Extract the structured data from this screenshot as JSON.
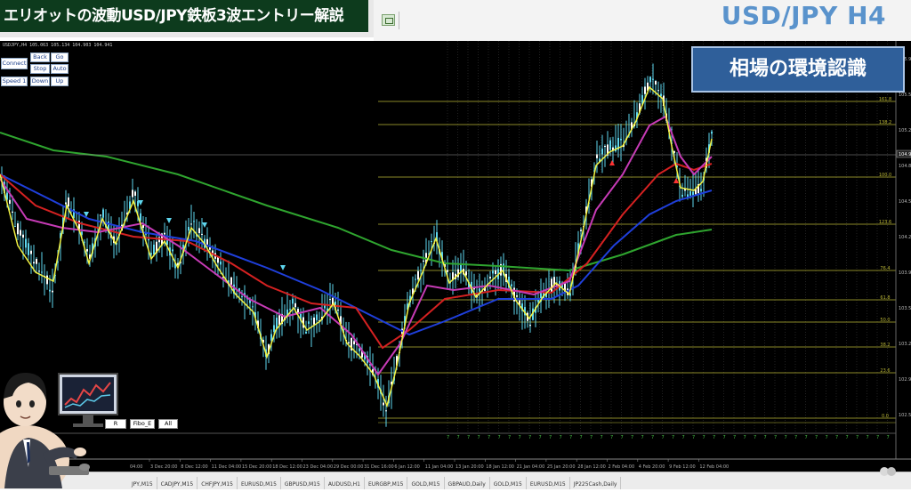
{
  "banner": {
    "title": "エリオットの波動USD/JPY鉄板3波エントリー解説"
  },
  "header": {
    "symbol_title": "USD/JPY H4"
  },
  "chart_header": {
    "info": "USDJPY,H4  105.063 105.134 104.903 104.941"
  },
  "controls": {
    "connect": "Connect",
    "back": "Back",
    "go": "Go",
    "stop": "Stop",
    "auto": "Auto",
    "speed": "Speed 1",
    "down": "Down",
    "up": "Up"
  },
  "fibo_buttons": {
    "fibo_r": "R",
    "fibo_e": "Fibo_E",
    "all": "All"
  },
  "overlay_label": "相場の環境認識",
  "price_labels": [
    "161.8",
    "138.2",
    "100.0",
    "123.6",
    "76.4",
    "61.8",
    "50.0",
    "38.2",
    "23.6",
    "0.0"
  ],
  "price_axis": [
    "105.9",
    "105.5",
    "105.2",
    "104.8",
    "104.5",
    "104.2",
    "103.9",
    "103.5",
    "103.2",
    "102.9",
    "102.5"
  ],
  "current_price": "104.94",
  "time_labels": [
    "3 Dec 20:00",
    "8 Dec 12:00",
    "11 Dec 04:00",
    "15 Dec 20:00",
    "18 Dec 12:00",
    "23 Dec 04:00",
    "29 Dec 00:00",
    "31 Dec 16:00",
    "6 Jan 12:00",
    "11 Jan 04:00",
    "13 Jan 20:00",
    "18 Jan 12:00",
    "21 Jan 04:00",
    "25 Jan 20:00",
    "28 Jan 12:00",
    "2 Feb 04:00",
    "4 Feb 20:00",
    "9 Feb 12:00",
    "12 Feb 04:00"
  ],
  "time_label_first": "04:00",
  "tabs": [
    "JPY,M15",
    "CADJPY,M15",
    "CHFJPY,M15",
    "EURUSD,M15",
    "GBPUSD,M15",
    "AUDUSD,H1",
    "EURGBP,M15",
    "GOLD,M15",
    "GBPAUD,Daily",
    "GOLD,M15",
    "EURUSD,M15",
    "JP225Cash,Daily"
  ],
  "colors": {
    "ma_green": "#2fa52f",
    "ma_blue": "#1f3fdb",
    "ma_red": "#d52121",
    "ma_magenta": "#c73bb6",
    "ma_yellow": "#f3f342",
    "candle": "#5ed6ee",
    "fib": "#b9b536",
    "accent": "#2f5f9a"
  }
}
